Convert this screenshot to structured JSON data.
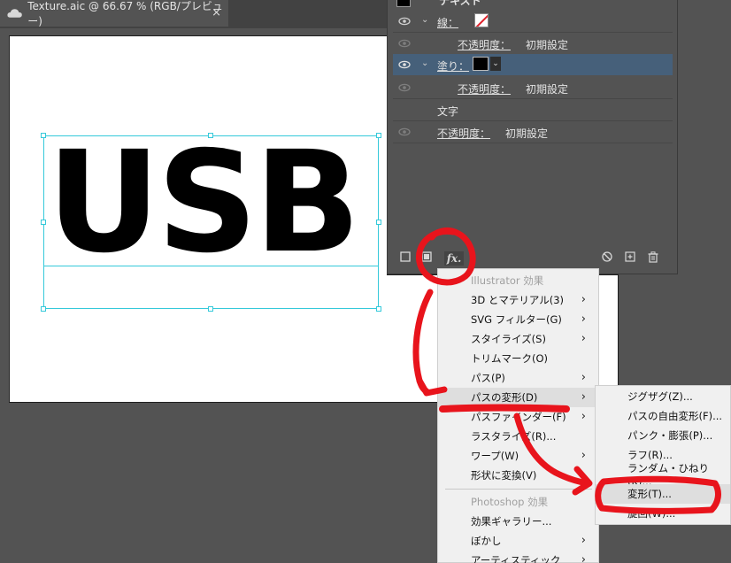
{
  "document_tab": {
    "title": "Texture.aic @ 66.67 % (RGB/プレビュー)",
    "close": "×"
  },
  "artboard": {
    "text": "USB"
  },
  "appearance_panel": {
    "top_label": "テキスト",
    "stroke_label": "線：",
    "opacity_label": "不透明度：",
    "opacity_value": "初期設定",
    "fill_label": "塗り：",
    "character_label": "文字"
  },
  "effect_menu": {
    "illustrator_header": "Illustrator 効果",
    "items_illustrator": [
      {
        "label": "3D とマテリアル(3)",
        "submenu": true
      },
      {
        "label": "SVG フィルター(G)",
        "submenu": true
      },
      {
        "label": "スタイライズ(S)",
        "submenu": true
      },
      {
        "label": "トリムマーク(O)",
        "submenu": false
      },
      {
        "label": "パス(P)",
        "submenu": true
      },
      {
        "label": "パスの変形(D)",
        "submenu": true
      },
      {
        "label": "パスファインダー(F)",
        "submenu": true
      },
      {
        "label": "ラスタライズ(R)...",
        "submenu": false
      },
      {
        "label": "ワープ(W)",
        "submenu": true
      },
      {
        "label": "形状に変換(V)",
        "submenu": true
      }
    ],
    "photoshop_header": "Photoshop 効果",
    "items_photoshop": [
      {
        "label": "効果ギャラリー...",
        "submenu": false
      },
      {
        "label": "ぼかし",
        "submenu": true
      },
      {
        "label": "アーティスティック",
        "submenu": true
      }
    ]
  },
  "distort_submenu": {
    "items": [
      "ジグザグ(Z)...",
      "パスの自由変形(F)...",
      "パンク・膨張(P)...",
      "ラフ(R)...",
      "ランダム・ひねり(K)...",
      "変形(T)...",
      "旋回(W)..."
    ]
  },
  "colors": {
    "annotation_red": "#e8141c",
    "selection_cyan": "#35c9da",
    "selected_row": "#46607a"
  }
}
